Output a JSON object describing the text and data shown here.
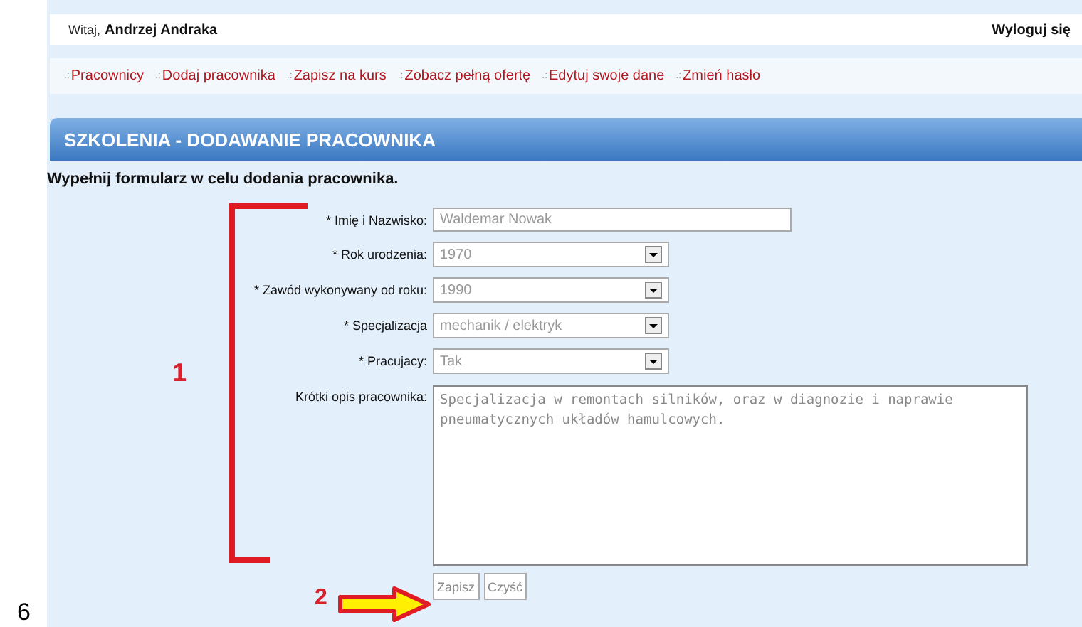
{
  "header": {
    "greeting": "Witaj,",
    "user": "Andrzej Andraka",
    "logout": "Wyloguj się"
  },
  "nav": [
    {
      "bullet": ".:",
      "label": "Pracownicy"
    },
    {
      "bullet": ".:",
      "label": "Dodaj pracownika"
    },
    {
      "bullet": ".:",
      "label": "Zapisz na kurs"
    },
    {
      "bullet": ".:",
      "label": "Zobacz pełną ofertę"
    },
    {
      "bullet": ".:",
      "label": "Edytuj swoje dane"
    },
    {
      "bullet": ".:",
      "label": "Zmień hasło"
    }
  ],
  "heading": "SZKOLENIA - DODAWANIE PRACOWNIKA",
  "instruction": "Wypełnij formularz w celu dodania pracownika.",
  "fields": [
    {
      "kind": "text",
      "label": "* Imię i Nazwisko:",
      "value": "Waldemar Nowak"
    },
    {
      "kind": "select",
      "label": "* Rok urodzenia:",
      "value": "1970"
    },
    {
      "kind": "select",
      "label": "* Zawód wykonywany od roku:",
      "value": "1990"
    },
    {
      "kind": "select",
      "label": "* Specjalizacja",
      "value": "mechanik / elektryk"
    },
    {
      "kind": "select",
      "label": "* Pracujacy:",
      "value": "Tak"
    },
    {
      "kind": "textarea",
      "label": "Krótki opis pracownika:",
      "value": "Specjalizacja w remontach silników, oraz w diagnozie i naprawie pneumatycznych układów hamulcowych."
    }
  ],
  "buttons": [
    "Zapisz",
    "Czyść"
  ],
  "annotations": [
    "1",
    "2"
  ],
  "page_number": "6"
}
